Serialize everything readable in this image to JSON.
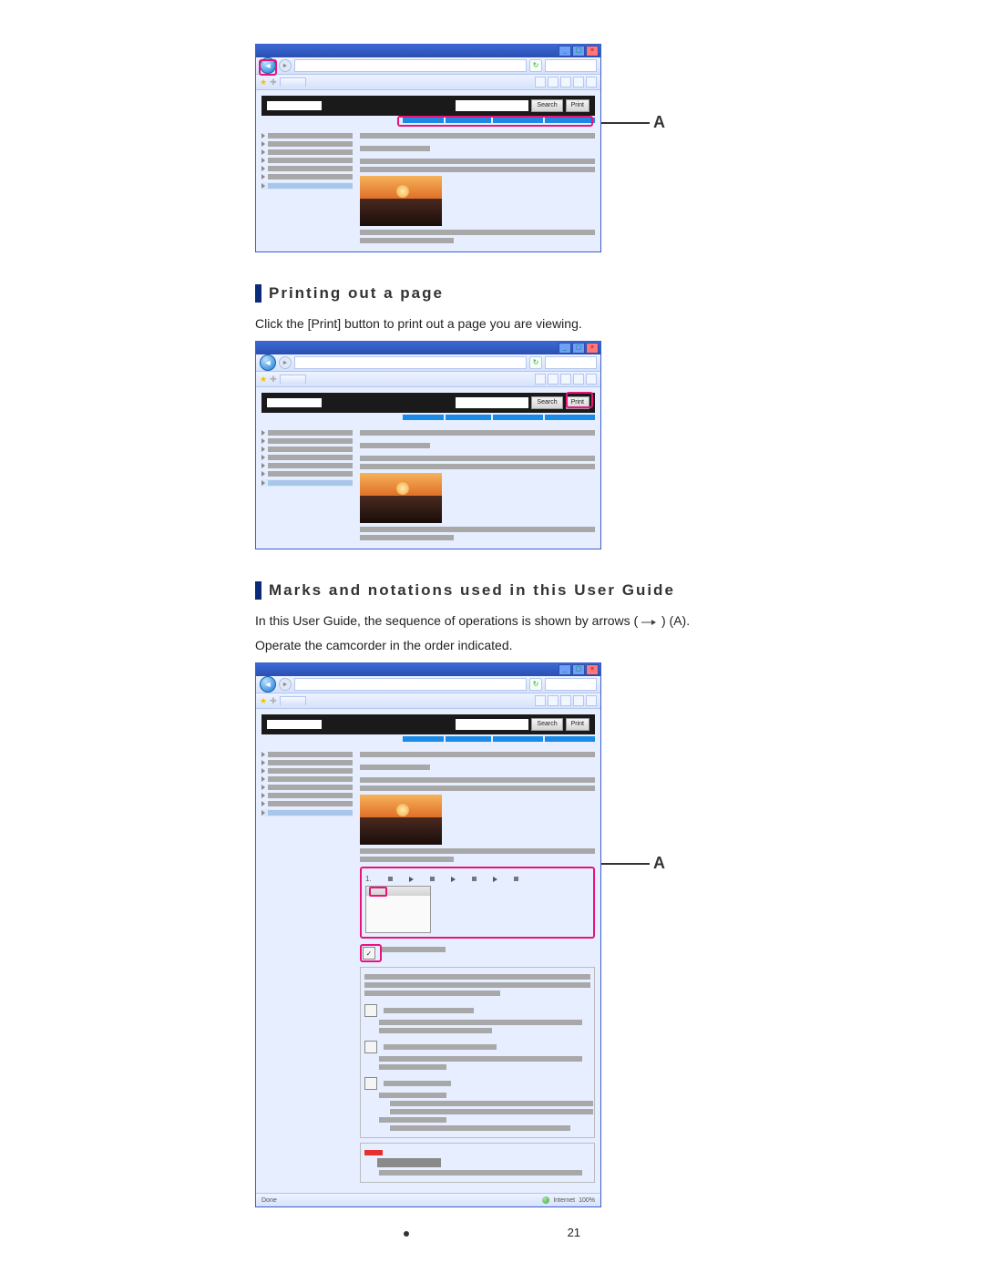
{
  "callout": {
    "labelA": "A"
  },
  "browser": {
    "searchBtn": "Search",
    "printBtn": "Print",
    "statusDone": "Done",
    "statusInternet": "Internet",
    "statusZoom": "100%"
  },
  "section1": {
    "heading": "Printing out a page",
    "body": "Click the [Print] button to print out a page you are viewing."
  },
  "section2": {
    "heading": "Marks and notations used in this User Guide",
    "body1_pre": "In this User Guide, the sequence of operations is shown by arrows ( ",
    "body1_post": " ) (A).",
    "body2": "Operate the camcorder in the order indicated."
  },
  "pageNumber": "21"
}
